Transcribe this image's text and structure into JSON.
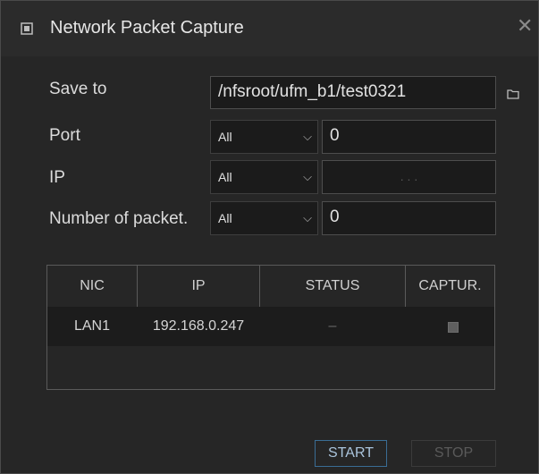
{
  "window": {
    "title": "Network Packet Capture",
    "close_glyph": "✕"
  },
  "form": {
    "save_to": {
      "label": "Save to",
      "value": "/nfsroot/ufm_b1/test0321"
    },
    "port": {
      "label": "Port",
      "select": "All",
      "value": "0"
    },
    "ip": {
      "label": "IP",
      "select": "All",
      "value": ".          .          ."
    },
    "packets": {
      "label": "Number of packet.",
      "select": "All",
      "value": "0"
    }
  },
  "table": {
    "headers": [
      "NIC",
      "IP",
      "STATUS",
      "CAPTUR."
    ],
    "rows": [
      {
        "nic": "LAN1",
        "ip": "192.168.0.247",
        "status": "–",
        "capture": true
      }
    ]
  },
  "buttons": {
    "start": "START",
    "stop": "STOP"
  },
  "colors": {
    "background": "#262626",
    "accent_border": "#3a6d95"
  },
  "icons": {
    "title": "capture-icon",
    "folder": "folder-icon",
    "close": "close-icon",
    "chevron": "chevron-down-icon",
    "checkbox": "checkbox-checked-icon"
  }
}
